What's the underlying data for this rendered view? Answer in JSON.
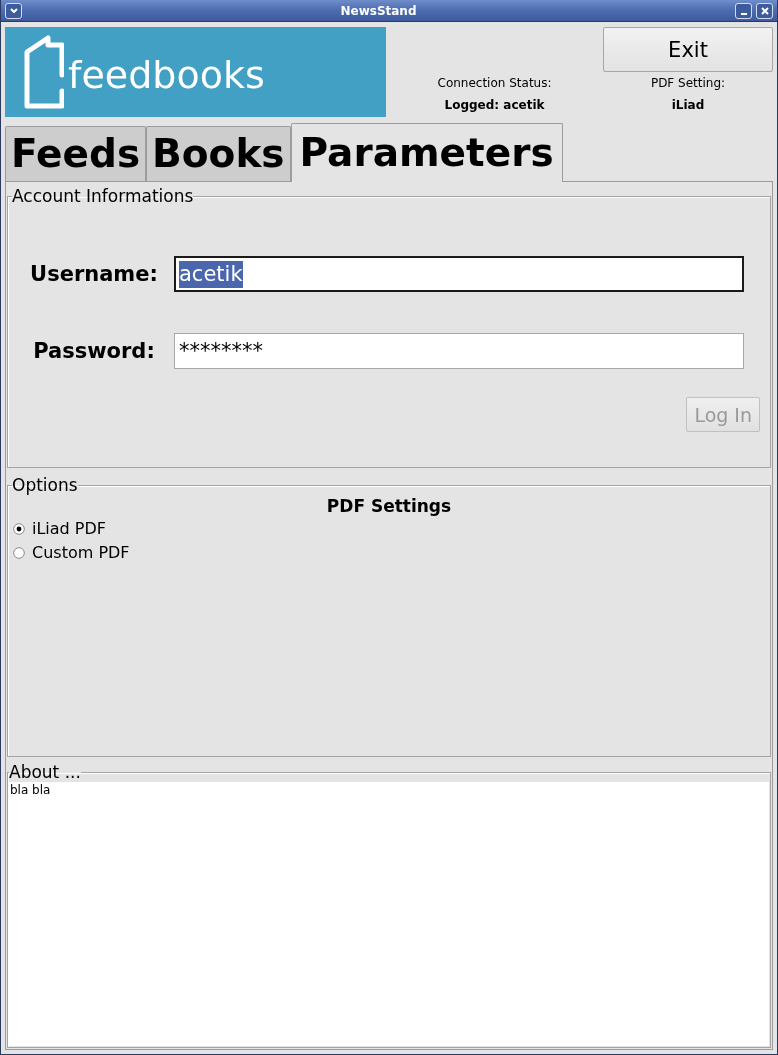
{
  "window": {
    "title": "NewsStand"
  },
  "header": {
    "logo_text": "feedbooks",
    "exit_button": "Exit",
    "connection_status": {
      "label": "Connection Status:",
      "value": "Logged: acetik"
    },
    "pdf_setting": {
      "label": "PDF Setting:",
      "value": "iLiad"
    }
  },
  "tabs": [
    {
      "label": "Feeds",
      "selected": false
    },
    {
      "label": "Books",
      "selected": false
    },
    {
      "label": "Parameters",
      "selected": true
    }
  ],
  "account": {
    "title": "Account Informations",
    "fields": [
      {
        "label": "Username:",
        "value": "acetik",
        "focused": true
      },
      {
        "label": "Password:",
        "value": "********",
        "focused": false
      }
    ],
    "login_button": {
      "label": "Log In",
      "disabled": true
    }
  },
  "options": {
    "title": "Options",
    "heading": "PDF Settings",
    "radios": [
      {
        "label": "iLiad PDF",
        "selected": true
      },
      {
        "label": "Custom PDF",
        "selected": false
      }
    ]
  },
  "about": {
    "title": "About ...",
    "text": "bla bla"
  }
}
